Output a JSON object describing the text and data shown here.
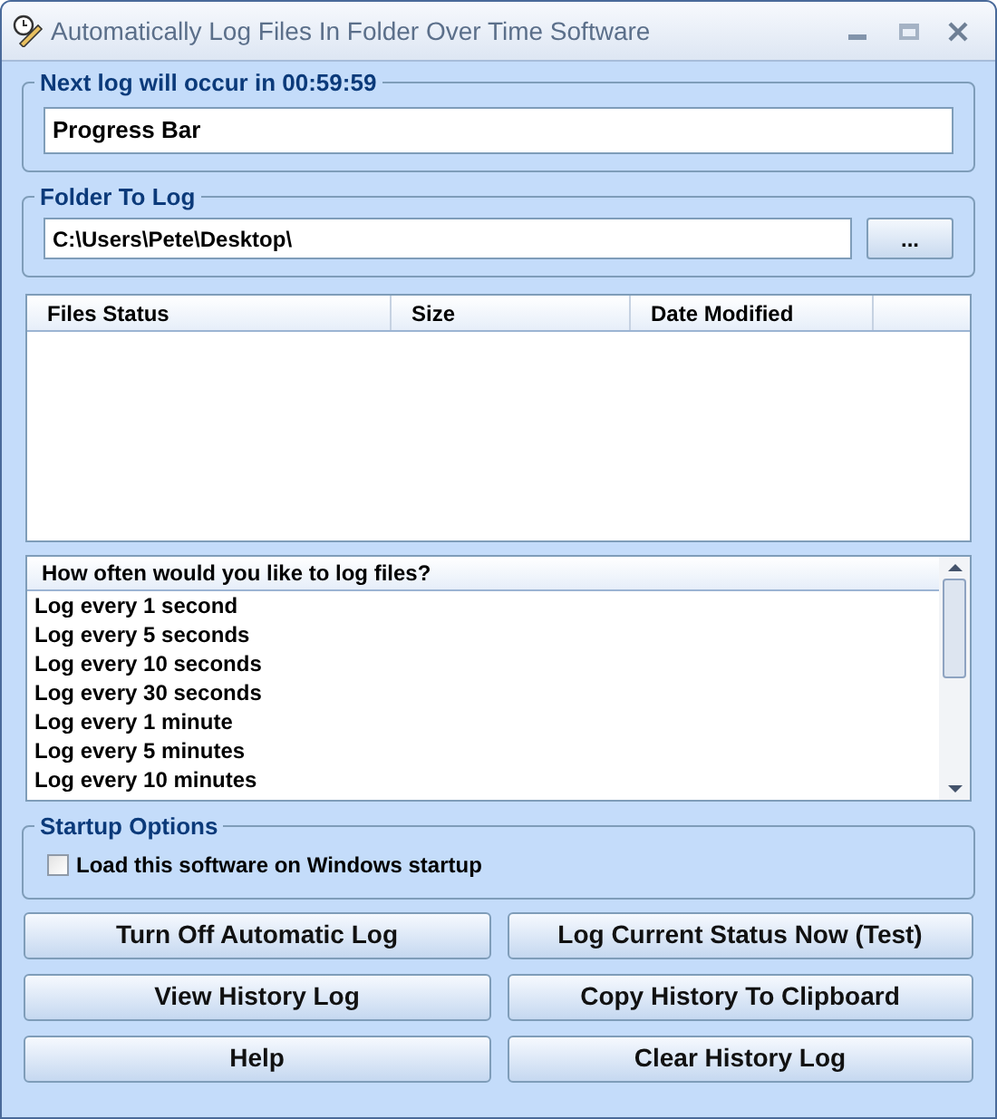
{
  "window": {
    "title": "Automatically Log Files In Folder Over Time Software"
  },
  "schedule": {
    "title": "Next log will occur in 00:59:59",
    "progress_label": "Progress Bar"
  },
  "folder": {
    "title": "Folder To Log",
    "value": "C:\\Users\\Pete\\Desktop\\",
    "browse_button": "..."
  },
  "files_table": {
    "columns": [
      "Files Status",
      "Size",
      "Date Modified"
    ]
  },
  "frequency_list": {
    "header": "How often would you like to log files?",
    "items": [
      {
        "label": "Log every 1 second"
      },
      {
        "label": "Log every 5 seconds"
      },
      {
        "label": "Log every 10 seconds"
      },
      {
        "label": "Log every 30 seconds"
      },
      {
        "label": "Log every 1 minute"
      },
      {
        "label": "Log every 5 minutes"
      },
      {
        "label": "Log every 10 minutes"
      }
    ]
  },
  "startup": {
    "title": "Startup Options",
    "option": {
      "label": "Load this software on Windows startup",
      "checked": false
    }
  },
  "buttons": [
    "Turn Off Automatic Log",
    "Log Current Status Now (Test)",
    "View History Log",
    "Copy History To Clipboard",
    "Help",
    "Clear History Log"
  ]
}
